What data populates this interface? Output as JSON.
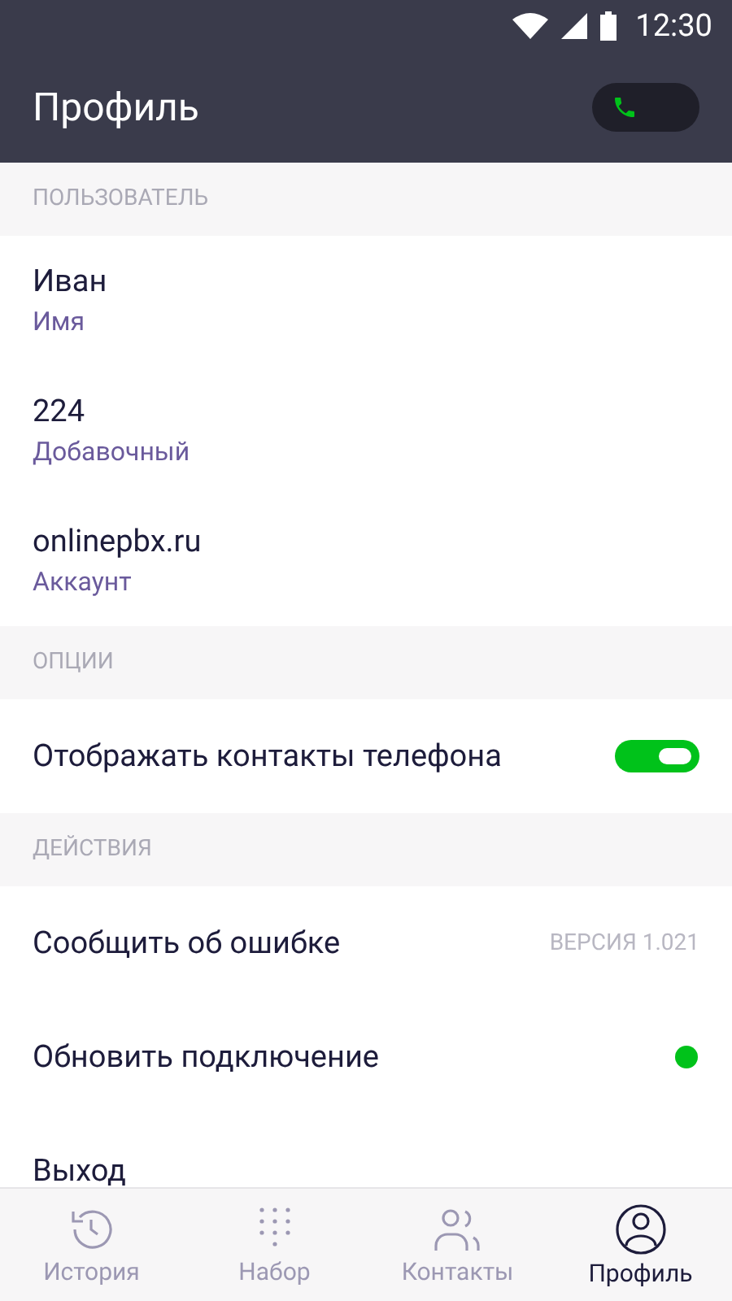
{
  "status_bar": {
    "time": "12:30"
  },
  "header": {
    "title": "Профиль",
    "call_toggle": {
      "on": true
    }
  },
  "sections": [
    {
      "title": "ПОЛЬЗОВАТЕЛЬ",
      "items": [
        {
          "kind": "field",
          "value": "Иван",
          "label": "Имя"
        },
        {
          "kind": "field",
          "value": "224",
          "label": "Добавочный"
        },
        {
          "kind": "field",
          "value": "onlinepbx.ru",
          "label": "Аккаунт"
        }
      ]
    },
    {
      "title": "ОПЦИИ",
      "items": [
        {
          "kind": "switch",
          "label": "Отображать контакты телефона",
          "on": true
        }
      ]
    },
    {
      "title": "ДЕЙСТВИЯ",
      "items": [
        {
          "kind": "action",
          "label": "Сообщить об ошибке",
          "note": "ВЕРСИЯ 1.021"
        },
        {
          "kind": "status",
          "label": "Обновить подключение",
          "color": "#00c21a"
        },
        {
          "kind": "action",
          "label": "Выход"
        }
      ]
    }
  ],
  "tabs": [
    {
      "kind": "history",
      "label": "История",
      "selected": false
    },
    {
      "kind": "dialpad",
      "label": "Набор",
      "selected": false
    },
    {
      "kind": "contacts",
      "label": "Контакты",
      "selected": false
    },
    {
      "kind": "profile",
      "label": "Профиль",
      "selected": true
    }
  ]
}
